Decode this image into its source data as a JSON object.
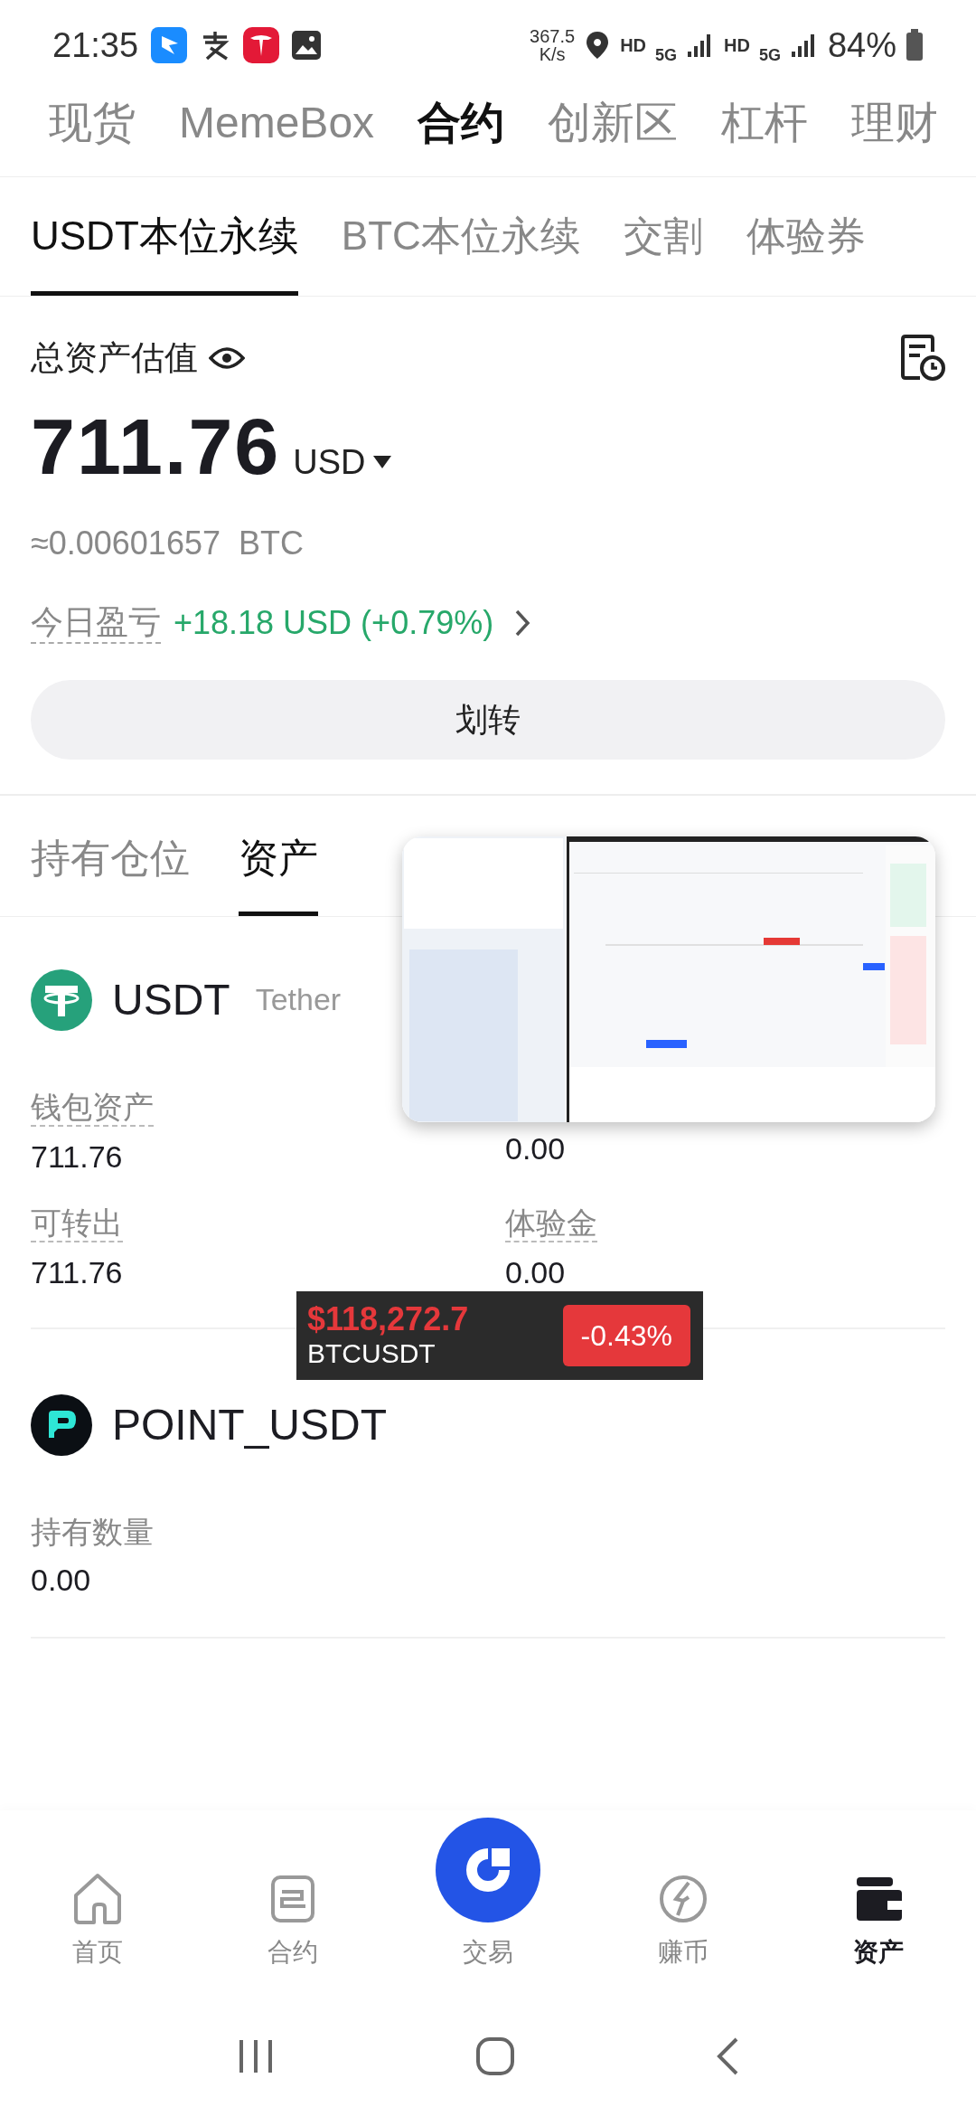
{
  "status_bar": {
    "time": "21:35",
    "speed": "367.5",
    "speed_unit": "K/s",
    "hd_1": "HD",
    "net_1": "5G",
    "hd_2": "HD",
    "net_2": "5G",
    "battery": "84%"
  },
  "top_tabs": [
    {
      "label": "现货",
      "selected": false
    },
    {
      "label": "MemeBox",
      "selected": false
    },
    {
      "label": "合约",
      "selected": true
    },
    {
      "label": "创新区",
      "selected": false
    },
    {
      "label": "杠杆",
      "selected": false
    },
    {
      "label": "理财",
      "selected": false
    }
  ],
  "sub_tabs": [
    {
      "label": "USDT本位永续",
      "selected": true
    },
    {
      "label": "BTC本位永续",
      "selected": false
    },
    {
      "label": "交割",
      "selected": false
    },
    {
      "label": "体验券",
      "selected": false
    }
  ],
  "summary": {
    "title": "总资产估值",
    "amount": "711.76",
    "currency": "USD",
    "btc": "≈0.00601657  BTC",
    "pnl_label": "今日盈亏",
    "pnl": "+18.18 USD (+0.79%)",
    "transfer": "划转"
  },
  "asset_tabs": [
    {
      "label": "持有仓位",
      "selected": false
    },
    {
      "label": "资产",
      "selected": true
    }
  ],
  "assets": [
    {
      "kind": "usdt",
      "symbol": "USDT",
      "name": "Tether",
      "fields": [
        {
          "label": "钱包资产",
          "value": "711.76"
        },
        {
          "value": "0.00"
        },
        {
          "label": "可转出",
          "value": "711.76"
        },
        {
          "label": "体验金",
          "value": "0.00"
        }
      ]
    },
    {
      "kind": "point",
      "symbol": "POINT_USDT",
      "fields": [
        {
          "label": "持有数量",
          "value": "0.00"
        }
      ]
    }
  ],
  "ticker": {
    "price": "$118,272.7",
    "pair": "BTCUSDT",
    "change": "-0.43%"
  },
  "bottom_nav": [
    {
      "kind": "home",
      "label": "首页",
      "selected": false
    },
    {
      "kind": "contract",
      "label": "合约",
      "selected": false
    },
    {
      "kind": "trade",
      "label": "交易",
      "selected": false
    },
    {
      "kind": "earn",
      "label": "赚币",
      "selected": false
    },
    {
      "kind": "assets",
      "label": "资产",
      "selected": true
    }
  ]
}
